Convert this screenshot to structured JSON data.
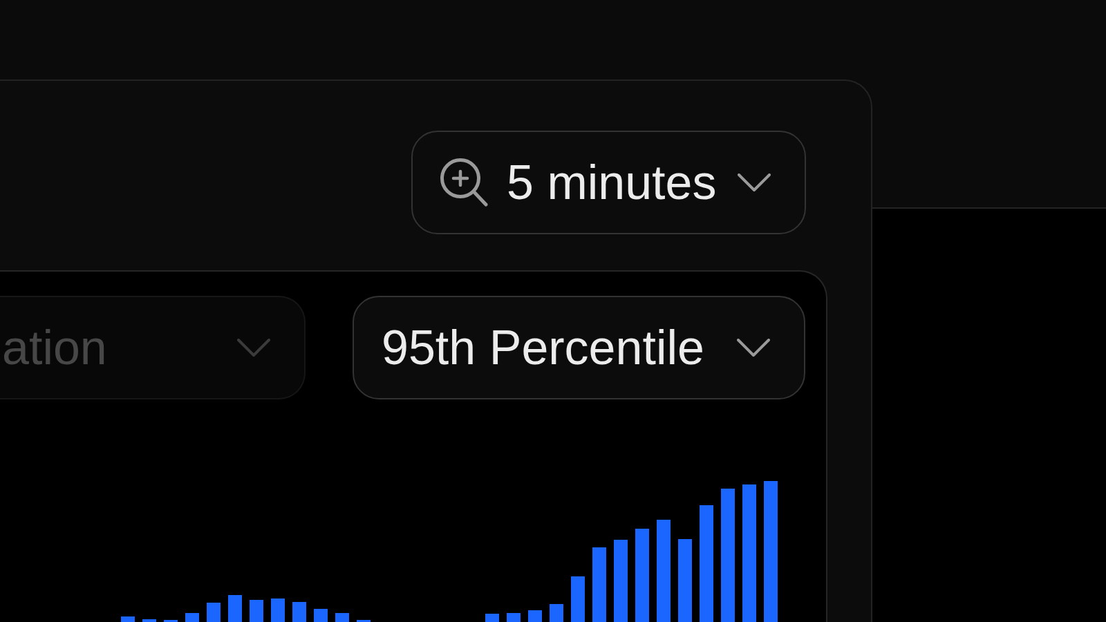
{
  "time_range_dropdown": {
    "label": "5 minutes",
    "disabled": false
  },
  "filter_dropdowns": [
    {
      "label": "ation",
      "disabled": true
    },
    {
      "label": "95th Percentile",
      "disabled": false
    }
  ]
}
